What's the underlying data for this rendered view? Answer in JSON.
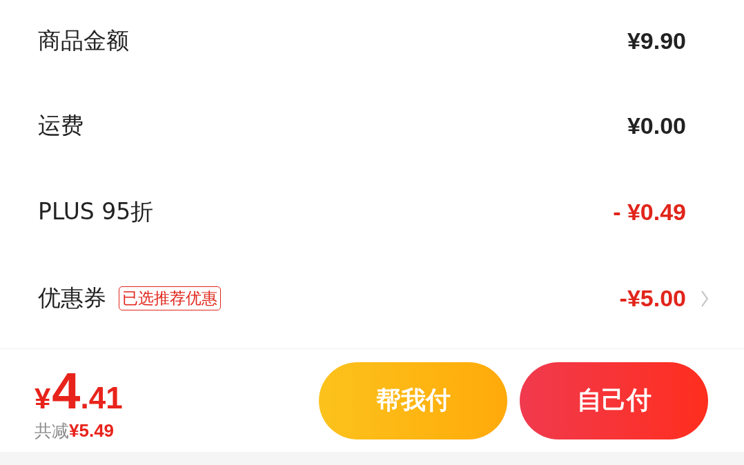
{
  "rows": [
    {
      "kind": "plain",
      "label": "商品金额",
      "value": "¥9.90"
    },
    {
      "kind": "plain",
      "label": "运费",
      "value": "¥0.00"
    },
    {
      "kind": "discount",
      "label": "PLUS 95折",
      "value": "- ¥0.49"
    },
    {
      "kind": "coupon",
      "label": "优惠券",
      "tag": "已选推荐优惠",
      "value": "-¥5.00"
    }
  ],
  "footer": {
    "price": {
      "currency": "¥",
      "integer": "4",
      "decimal": ".41"
    },
    "saved_label": "共减",
    "saved_amount": "¥5.49",
    "buttons": [
      {
        "kind": "secondary",
        "label": "帮我付"
      },
      {
        "kind": "primary",
        "label": "自己付"
      }
    ]
  }
}
